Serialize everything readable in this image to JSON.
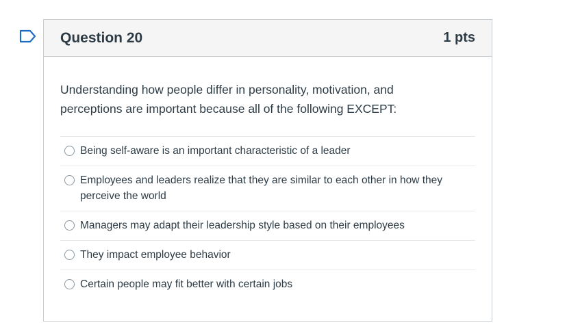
{
  "question": {
    "title": "Question 20",
    "points": "1 pts",
    "prompt": "Understanding how people differ in personality, motivation, and perceptions are important because all of the following EXCEPT:",
    "answers": [
      {
        "label": "Being self-aware is an important characteristic of a leader"
      },
      {
        "label": "Employees and leaders realize that they are similar to each other in how they perceive the world"
      },
      {
        "label": "Managers may adapt their leadership style based on their employees"
      },
      {
        "label": "They impact employee behavior"
      },
      {
        "label": "Certain people may fit better with certain jobs"
      }
    ]
  },
  "colors": {
    "flag": "#1f6ec4",
    "header_bg": "#f5f5f5",
    "border": "#c7cdd1",
    "text": "#2d3b45"
  },
  "icons": {
    "flag": "flag-question-icon",
    "radio": "radio-button-icon"
  }
}
